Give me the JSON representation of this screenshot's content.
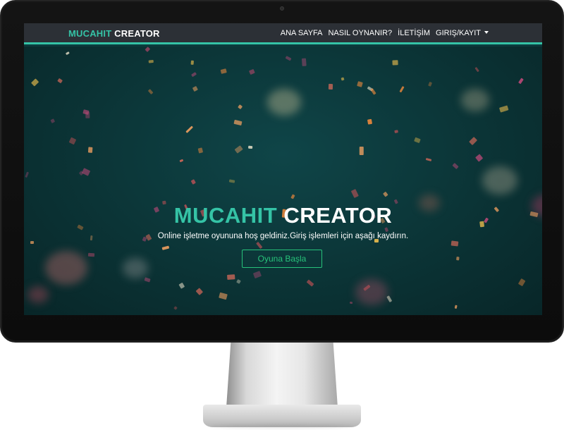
{
  "navbar": {
    "brand": {
      "part1": "MUCAHIT",
      "part2": "CREATOR"
    },
    "links": [
      "ANA SAYFA",
      "NASIL OYNANIR?",
      "İLETİŞİM",
      "GIRIŞ/KAYIT"
    ]
  },
  "hero": {
    "title": {
      "part1": "MUCAHIT",
      "part2": "CREATOR"
    },
    "subtitle": "Online işletme oyununa hoş geldiniz.Giriş işlemleri için aşağı kaydırın.",
    "button": "Oyuna Başla"
  },
  "colors": {
    "accent": "#35c3a6",
    "button": "#27c27a",
    "navbar": "#2c3036",
    "hero_bg": "#0c3b3d"
  },
  "icons": {
    "dropdown": "caret-down-icon",
    "camera": "camera-icon"
  }
}
